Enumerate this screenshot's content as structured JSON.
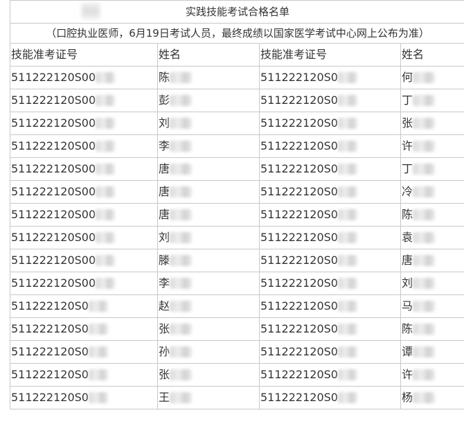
{
  "title": "实践技能考试合格名单",
  "subtitle": "（口腔执业医师，6月19日考试人员，最终成绩以国家医学考试中心网上公布为准）",
  "headers": [
    "技能准考证号",
    "姓名",
    "技能准考证号",
    "姓名"
  ],
  "rows": [
    [
      "511222120S00",
      "陈",
      "511222120S0",
      "何"
    ],
    [
      "511222120S00",
      "彭",
      "511222120S0",
      "丁"
    ],
    [
      "511222120S00",
      "刘",
      "511222120S0",
      "张"
    ],
    [
      "511222120S00",
      "李",
      "511222120S0",
      "许"
    ],
    [
      "511222120S00",
      "唐",
      "511222120S0",
      "丁"
    ],
    [
      "511222120S00",
      "唐",
      "511222120S0",
      "冷"
    ],
    [
      "511222120S00",
      "唐",
      "511222120S0",
      "陈"
    ],
    [
      "511222120S00",
      "刘",
      "511222120S0",
      "袁"
    ],
    [
      "511222120S00",
      "滕",
      "511222120S0",
      "唐"
    ],
    [
      "511222120S00",
      "李",
      "511222120S0",
      "刘"
    ],
    [
      "511222120S0",
      "赵",
      "511222120S0",
      "马"
    ],
    [
      "511222120S0",
      "张",
      "511222120S0",
      "陈"
    ],
    [
      "511222120S0",
      "孙",
      "511222120S0",
      "谭"
    ],
    [
      "511222120S0",
      "张",
      "511222120S0",
      "许"
    ],
    [
      "511222120S0",
      "王",
      "511222120S0",
      "杨"
    ]
  ]
}
